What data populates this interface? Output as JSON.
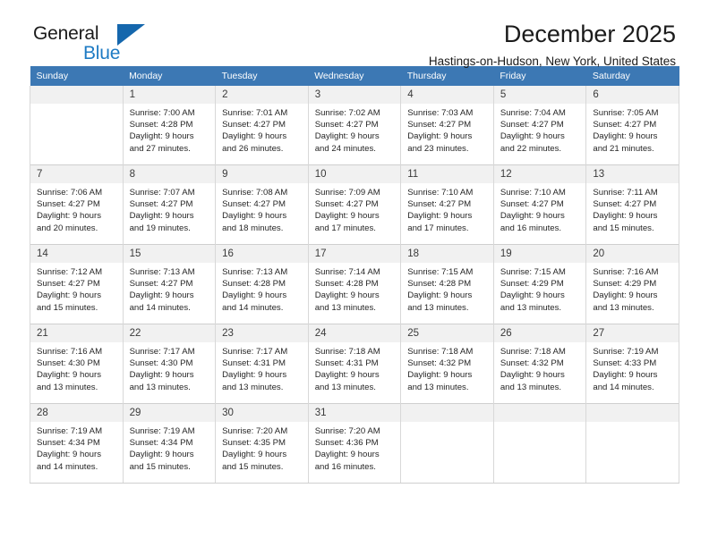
{
  "brand": {
    "name_part1": "General",
    "name_part2": "Blue",
    "flag_icon": "triangle-flag-icon",
    "accent_color": "#1567ad"
  },
  "header": {
    "title": "December 2025",
    "subtitle": "Hastings-on-Hudson, New York, United States"
  },
  "calendar": {
    "header_bg": "#3c78b4",
    "daynum_bg": "#f1f1f1",
    "weekdays": [
      "Sunday",
      "Monday",
      "Tuesday",
      "Wednesday",
      "Thursday",
      "Friday",
      "Saturday"
    ],
    "weeks": [
      [
        {
          "day": "",
          "sunrise": "",
          "sunset": "",
          "daylight1": "",
          "daylight2": ""
        },
        {
          "day": "1",
          "sunrise": "Sunrise: 7:00 AM",
          "sunset": "Sunset: 4:28 PM",
          "daylight1": "Daylight: 9 hours",
          "daylight2": "and 27 minutes."
        },
        {
          "day": "2",
          "sunrise": "Sunrise: 7:01 AM",
          "sunset": "Sunset: 4:27 PM",
          "daylight1": "Daylight: 9 hours",
          "daylight2": "and 26 minutes."
        },
        {
          "day": "3",
          "sunrise": "Sunrise: 7:02 AM",
          "sunset": "Sunset: 4:27 PM",
          "daylight1": "Daylight: 9 hours",
          "daylight2": "and 24 minutes."
        },
        {
          "day": "4",
          "sunrise": "Sunrise: 7:03 AM",
          "sunset": "Sunset: 4:27 PM",
          "daylight1": "Daylight: 9 hours",
          "daylight2": "and 23 minutes."
        },
        {
          "day": "5",
          "sunrise": "Sunrise: 7:04 AM",
          "sunset": "Sunset: 4:27 PM",
          "daylight1": "Daylight: 9 hours",
          "daylight2": "and 22 minutes."
        },
        {
          "day": "6",
          "sunrise": "Sunrise: 7:05 AM",
          "sunset": "Sunset: 4:27 PM",
          "daylight1": "Daylight: 9 hours",
          "daylight2": "and 21 minutes."
        }
      ],
      [
        {
          "day": "7",
          "sunrise": "Sunrise: 7:06 AM",
          "sunset": "Sunset: 4:27 PM",
          "daylight1": "Daylight: 9 hours",
          "daylight2": "and 20 minutes."
        },
        {
          "day": "8",
          "sunrise": "Sunrise: 7:07 AM",
          "sunset": "Sunset: 4:27 PM",
          "daylight1": "Daylight: 9 hours",
          "daylight2": "and 19 minutes."
        },
        {
          "day": "9",
          "sunrise": "Sunrise: 7:08 AM",
          "sunset": "Sunset: 4:27 PM",
          "daylight1": "Daylight: 9 hours",
          "daylight2": "and 18 minutes."
        },
        {
          "day": "10",
          "sunrise": "Sunrise: 7:09 AM",
          "sunset": "Sunset: 4:27 PM",
          "daylight1": "Daylight: 9 hours",
          "daylight2": "and 17 minutes."
        },
        {
          "day": "11",
          "sunrise": "Sunrise: 7:10 AM",
          "sunset": "Sunset: 4:27 PM",
          "daylight1": "Daylight: 9 hours",
          "daylight2": "and 17 minutes."
        },
        {
          "day": "12",
          "sunrise": "Sunrise: 7:10 AM",
          "sunset": "Sunset: 4:27 PM",
          "daylight1": "Daylight: 9 hours",
          "daylight2": "and 16 minutes."
        },
        {
          "day": "13",
          "sunrise": "Sunrise: 7:11 AM",
          "sunset": "Sunset: 4:27 PM",
          "daylight1": "Daylight: 9 hours",
          "daylight2": "and 15 minutes."
        }
      ],
      [
        {
          "day": "14",
          "sunrise": "Sunrise: 7:12 AM",
          "sunset": "Sunset: 4:27 PM",
          "daylight1": "Daylight: 9 hours",
          "daylight2": "and 15 minutes."
        },
        {
          "day": "15",
          "sunrise": "Sunrise: 7:13 AM",
          "sunset": "Sunset: 4:27 PM",
          "daylight1": "Daylight: 9 hours",
          "daylight2": "and 14 minutes."
        },
        {
          "day": "16",
          "sunrise": "Sunrise: 7:13 AM",
          "sunset": "Sunset: 4:28 PM",
          "daylight1": "Daylight: 9 hours",
          "daylight2": "and 14 minutes."
        },
        {
          "day": "17",
          "sunrise": "Sunrise: 7:14 AM",
          "sunset": "Sunset: 4:28 PM",
          "daylight1": "Daylight: 9 hours",
          "daylight2": "and 13 minutes."
        },
        {
          "day": "18",
          "sunrise": "Sunrise: 7:15 AM",
          "sunset": "Sunset: 4:28 PM",
          "daylight1": "Daylight: 9 hours",
          "daylight2": "and 13 minutes."
        },
        {
          "day": "19",
          "sunrise": "Sunrise: 7:15 AM",
          "sunset": "Sunset: 4:29 PM",
          "daylight1": "Daylight: 9 hours",
          "daylight2": "and 13 minutes."
        },
        {
          "day": "20",
          "sunrise": "Sunrise: 7:16 AM",
          "sunset": "Sunset: 4:29 PM",
          "daylight1": "Daylight: 9 hours",
          "daylight2": "and 13 minutes."
        }
      ],
      [
        {
          "day": "21",
          "sunrise": "Sunrise: 7:16 AM",
          "sunset": "Sunset: 4:30 PM",
          "daylight1": "Daylight: 9 hours",
          "daylight2": "and 13 minutes."
        },
        {
          "day": "22",
          "sunrise": "Sunrise: 7:17 AM",
          "sunset": "Sunset: 4:30 PM",
          "daylight1": "Daylight: 9 hours",
          "daylight2": "and 13 minutes."
        },
        {
          "day": "23",
          "sunrise": "Sunrise: 7:17 AM",
          "sunset": "Sunset: 4:31 PM",
          "daylight1": "Daylight: 9 hours",
          "daylight2": "and 13 minutes."
        },
        {
          "day": "24",
          "sunrise": "Sunrise: 7:18 AM",
          "sunset": "Sunset: 4:31 PM",
          "daylight1": "Daylight: 9 hours",
          "daylight2": "and 13 minutes."
        },
        {
          "day": "25",
          "sunrise": "Sunrise: 7:18 AM",
          "sunset": "Sunset: 4:32 PM",
          "daylight1": "Daylight: 9 hours",
          "daylight2": "and 13 minutes."
        },
        {
          "day": "26",
          "sunrise": "Sunrise: 7:18 AM",
          "sunset": "Sunset: 4:32 PM",
          "daylight1": "Daylight: 9 hours",
          "daylight2": "and 13 minutes."
        },
        {
          "day": "27",
          "sunrise": "Sunrise: 7:19 AM",
          "sunset": "Sunset: 4:33 PM",
          "daylight1": "Daylight: 9 hours",
          "daylight2": "and 14 minutes."
        }
      ],
      [
        {
          "day": "28",
          "sunrise": "Sunrise: 7:19 AM",
          "sunset": "Sunset: 4:34 PM",
          "daylight1": "Daylight: 9 hours",
          "daylight2": "and 14 minutes."
        },
        {
          "day": "29",
          "sunrise": "Sunrise: 7:19 AM",
          "sunset": "Sunset: 4:34 PM",
          "daylight1": "Daylight: 9 hours",
          "daylight2": "and 15 minutes."
        },
        {
          "day": "30",
          "sunrise": "Sunrise: 7:20 AM",
          "sunset": "Sunset: 4:35 PM",
          "daylight1": "Daylight: 9 hours",
          "daylight2": "and 15 minutes."
        },
        {
          "day": "31",
          "sunrise": "Sunrise: 7:20 AM",
          "sunset": "Sunset: 4:36 PM",
          "daylight1": "Daylight: 9 hours",
          "daylight2": "and 16 minutes."
        },
        {
          "day": "",
          "sunrise": "",
          "sunset": "",
          "daylight1": "",
          "daylight2": ""
        },
        {
          "day": "",
          "sunrise": "",
          "sunset": "",
          "daylight1": "",
          "daylight2": ""
        },
        {
          "day": "",
          "sunrise": "",
          "sunset": "",
          "daylight1": "",
          "daylight2": ""
        }
      ]
    ]
  }
}
